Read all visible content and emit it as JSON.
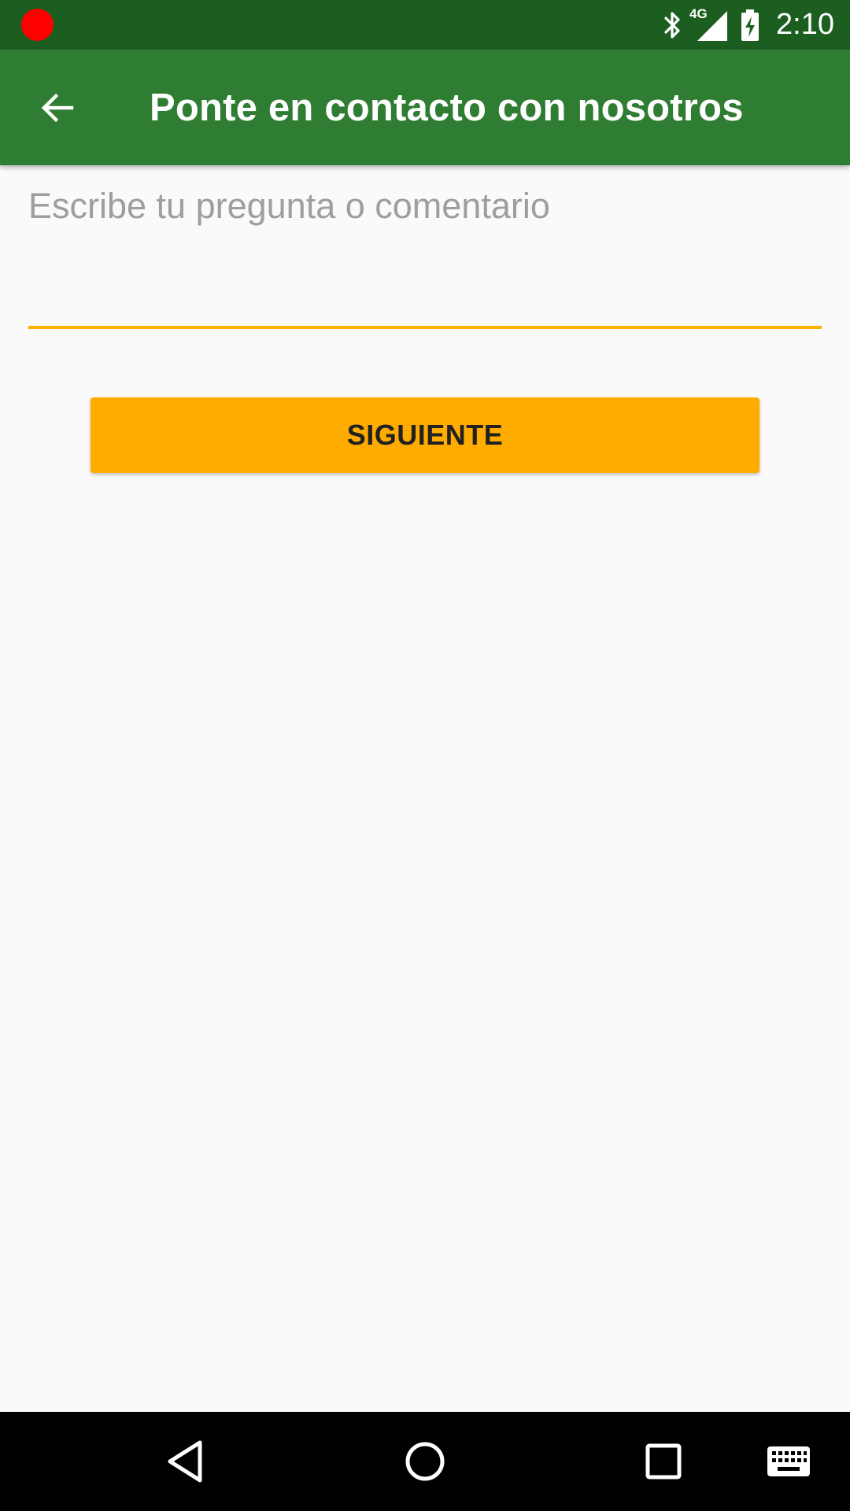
{
  "status_bar": {
    "time": "2:10",
    "network_label": "4G",
    "icons": [
      "record-dot-icon",
      "bluetooth-icon",
      "signal-icon",
      "battery-charging-icon"
    ]
  },
  "app_bar": {
    "title": "Ponte en contacto con nosotros",
    "back_icon": "arrow-back-icon",
    "color": "#2e7d32"
  },
  "form": {
    "message_placeholder": "Escribe tu pregunta o comentario",
    "message_value": "",
    "accent_color": "#ffb300"
  },
  "actions": {
    "next_label": "SIGUIENTE",
    "next_color": "#ffab00"
  },
  "nav_bar": {
    "icons": [
      "back-triangle-icon",
      "home-circle-icon",
      "recents-square-icon",
      "keyboard-icon"
    ]
  }
}
